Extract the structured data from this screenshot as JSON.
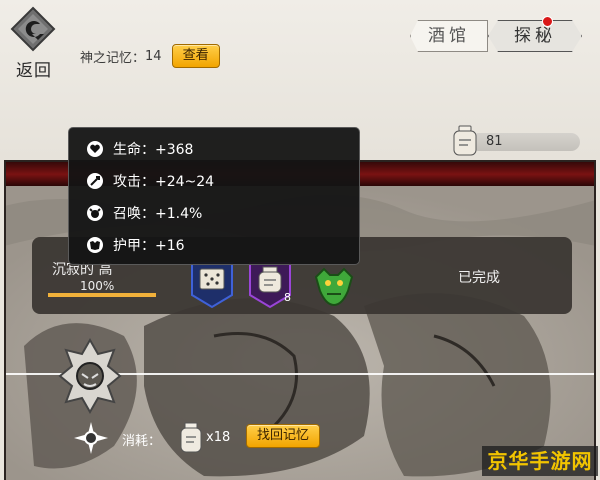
{
  "header": {
    "back_label": "返回",
    "faded_text": "·  ·  ·",
    "memory_label": "神之记忆：",
    "memory_count": "14",
    "view_button": "查看"
  },
  "tabs": [
    {
      "label": "酒馆",
      "active": false
    },
    {
      "label": "探秘",
      "active": true,
      "has_notification": true
    }
  ],
  "resource": {
    "value": "81",
    "icon": "jar-icon"
  },
  "tooltip": {
    "rows": [
      {
        "icon": "heart-icon",
        "text": "生命：+368"
      },
      {
        "icon": "sword-icon",
        "text": "攻击：+24~24"
      },
      {
        "icon": "summon-icon",
        "text": "召唤：+1.4%"
      },
      {
        "icon": "armor-icon",
        "text": "护甲：+16"
      }
    ]
  },
  "quest": {
    "title": "沉寂的 高",
    "progress": 1.0,
    "progress_text": "100%",
    "status": "已完成",
    "rewards": [
      {
        "icon": "rune-book-icon",
        "count": ""
      },
      {
        "icon": "jar-icon",
        "count": "8"
      },
      {
        "icon": "goblin-icon",
        "count": ""
      }
    ]
  },
  "consume": {
    "label": "消耗：",
    "count": "x18",
    "button": "找回记忆"
  },
  "watermark": "京华手游网",
  "colors": {
    "accent_gold": "#f2a400",
    "band_red": "#7a1212",
    "notification_red": "#d91818"
  }
}
